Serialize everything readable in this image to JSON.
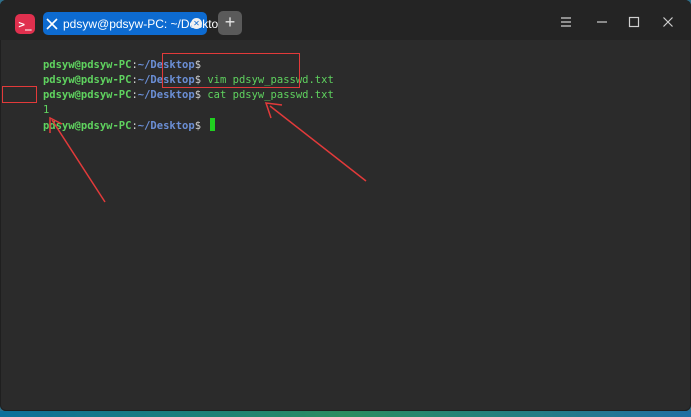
{
  "titlebar": {
    "app_icon_label": ">_",
    "tab_title": "pdsyw@pdsyw-PC: ~/Desktop",
    "new_tab_label": "+"
  },
  "terminal": {
    "prompt_user": "pdsyw@pdsyw-PC",
    "prompt_sep": ":",
    "prompt_path": "~/Desktop",
    "prompt_symbol": "$",
    "lines": [
      {
        "command": ""
      },
      {
        "command": " vim pdsyw_passwd.txt"
      },
      {
        "command": " cat pdsyw_passwd.txt"
      },
      {
        "output": "1"
      },
      {
        "command": " "
      }
    ]
  },
  "colors": {
    "accent_tab": "#0d6bd1",
    "annotation": "#e23a3a",
    "prompt_user": "#5fd35f",
    "prompt_path": "#6b8fd6"
  }
}
